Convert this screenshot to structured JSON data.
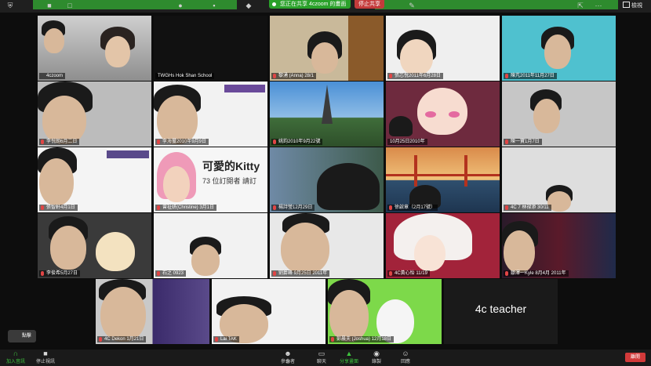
{
  "topbar": {
    "share_status": "您正在共享 4czoom 的畫面",
    "stop_share_label": "停止共享",
    "view_label": "檢視"
  },
  "tiles": [
    {
      "name": "4czoom",
      "active": true
    },
    {
      "name": "TWGHs Hok Shan School"
    },
    {
      "name": "黎湧 (Anna) 28/1"
    },
    {
      "name": "張芯悅2011年6月28日"
    },
    {
      "name": "陳芃2011年11月27日"
    },
    {
      "name": "李悅朗6月二日"
    },
    {
      "name": "李海璽2010年9月9日"
    },
    {
      "name": "姚鈞2010年9月22號"
    },
    {
      "name": "10月25日2010年"
    },
    {
      "name": "陳一寶1月7日"
    },
    {
      "name": "張智軒4月1日"
    },
    {
      "name": "曾祉妍(Christine) 3月1日"
    },
    {
      "name": "楊詩瑩12月29日"
    },
    {
      "name": "徐啟章（2月17號）"
    },
    {
      "name": "4C 7 林禄添 30/11"
    },
    {
      "name": "李俊希5月27日"
    },
    {
      "name": "石之 0923"
    },
    {
      "name": "劉爵峰 9月25日 2011年"
    },
    {
      "name": "4C黃心怡 11/19"
    },
    {
      "name": "鄒澤一Kyle 8月4月 2011年"
    },
    {
      "name": "4C Dekon 1月21日"
    },
    {
      "name": "Lai TAK"
    },
    {
      "name": "彭晨夫 (Joshua) 12月18日"
    },
    {
      "name": "4c teacher"
    }
  ],
  "kitty": {
    "title": "可愛的Kitty",
    "subtitle": "73 位訂閱者 請訂"
  },
  "tooltip_label": "點擊",
  "bottombar": {
    "audio": "加入音訊",
    "video": "停止視訊",
    "participants": "參會者",
    "participants_count": "24",
    "chat": "聊天",
    "share": "分享畫面",
    "record": "錄製",
    "reactions": "回應",
    "end": "離開"
  }
}
